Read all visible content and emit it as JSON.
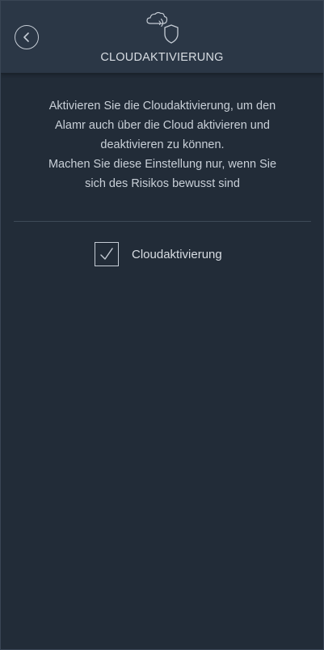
{
  "header": {
    "title": "CLOUDAKTIVIERUNG",
    "back_icon": "chevron-left-icon",
    "logo_icon": "cloud-shield-icon"
  },
  "description": {
    "lines": [
      "Aktivieren Sie die Cloudaktivierung, um den",
      "Alamr auch über die Cloud aktivieren und",
      "deaktivieren zu können.",
      "Machen Sie diese Einstellung nur, wenn Sie",
      "sich des Risikos bewusst sind"
    ]
  },
  "setting": {
    "label": "Cloudaktivierung",
    "checked": true,
    "check_icon": "checkmark-icon"
  },
  "colors": {
    "background": "#222c38",
    "header": "#2b3746",
    "text": "#d8dde3"
  }
}
